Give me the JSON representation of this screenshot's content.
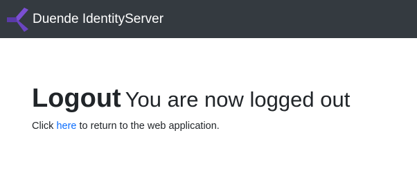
{
  "navbar": {
    "brand_name": "Duende IdentityServer",
    "logo_icon": "duende-logo-icon",
    "background_color": "#343a40",
    "logo_colors": [
      "#7b4fd3",
      "#5a3aa8"
    ]
  },
  "main": {
    "title": "Logout",
    "subtitle": "You are now logged out",
    "message_prefix": "Click ",
    "link_text": "here",
    "message_suffix": " to return to the web application.",
    "link_color": "#0d6efd"
  }
}
